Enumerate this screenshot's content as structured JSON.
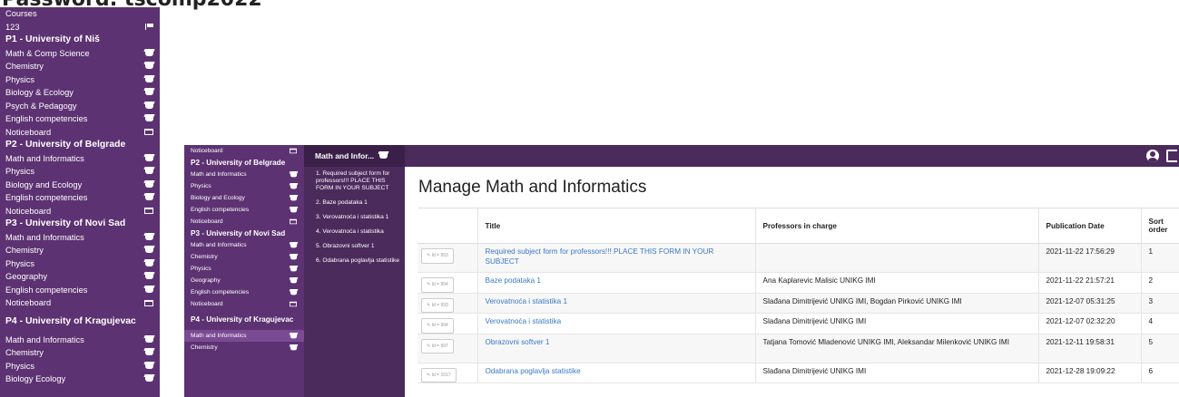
{
  "heading": "Password: tscomp2022",
  "sidebar_left": {
    "items": [
      {
        "label": "Courses",
        "type": "item",
        "icon": ""
      },
      {
        "label": "123",
        "type": "item",
        "icon": "flag-icon"
      },
      {
        "label": "P1 - University of Niš",
        "type": "head",
        "icon": ""
      },
      {
        "label": "Math & Comp Science",
        "type": "item",
        "icon": "graduation-cap-icon"
      },
      {
        "label": "Chemistry",
        "type": "item",
        "icon": "graduation-cap-icon"
      },
      {
        "label": "Physics",
        "type": "item",
        "icon": "graduation-cap-icon"
      },
      {
        "label": "Biology & Ecology",
        "type": "item",
        "icon": "graduation-cap-icon"
      },
      {
        "label": "Psych & Pedagogy",
        "type": "item",
        "icon": "graduation-cap-icon"
      },
      {
        "label": "English competencies",
        "type": "item",
        "icon": "graduation-cap-icon"
      },
      {
        "label": "Noticeboard",
        "type": "item",
        "icon": "noticeboard-icon"
      },
      {
        "label": "P2 - University of Belgrade",
        "type": "head",
        "icon": ""
      },
      {
        "label": "Math and Informatics",
        "type": "item",
        "icon": "graduation-cap-icon"
      },
      {
        "label": "Physics",
        "type": "item",
        "icon": "graduation-cap-icon"
      },
      {
        "label": "Biology and Ecology",
        "type": "item",
        "icon": "graduation-cap-icon"
      },
      {
        "label": "English competencies",
        "type": "item",
        "icon": "graduation-cap-icon"
      },
      {
        "label": "Noticeboard",
        "type": "item",
        "icon": "noticeboard-icon"
      },
      {
        "label": "P3 - University of Novi Sad",
        "type": "head",
        "icon": ""
      },
      {
        "label": "Math and Informatics",
        "type": "item",
        "icon": "graduation-cap-icon"
      },
      {
        "label": "Chemistry",
        "type": "item",
        "icon": "graduation-cap-icon"
      },
      {
        "label": "Physics",
        "type": "item",
        "icon": "graduation-cap-icon"
      },
      {
        "label": "Geography",
        "type": "item",
        "icon": "graduation-cap-icon"
      },
      {
        "label": "English competencies",
        "type": "item",
        "icon": "graduation-cap-icon"
      },
      {
        "label": "Noticeboard",
        "type": "item",
        "icon": "noticeboard-icon"
      },
      {
        "label": "P4 - University of Kragujevac",
        "type": "head-tall",
        "icon": ""
      },
      {
        "label": "Math and Informatics",
        "type": "item",
        "icon": "graduation-cap-icon"
      },
      {
        "label": "Chemistry",
        "type": "item",
        "icon": "graduation-cap-icon"
      },
      {
        "label": "Physics",
        "type": "item",
        "icon": "graduation-cap-icon"
      },
      {
        "label": "Biology Ecology",
        "type": "item",
        "icon": "graduation-cap-icon"
      }
    ]
  },
  "sidebar_mid": {
    "items": [
      {
        "label": "Noticeboard",
        "type": "item",
        "icon": "noticeboard-icon",
        "active": false
      },
      {
        "label": "P2 - University of Belgrade",
        "type": "head",
        "icon": "",
        "active": false
      },
      {
        "label": "Math and Informatics",
        "type": "item",
        "icon": "graduation-cap-icon",
        "active": false
      },
      {
        "label": "Physics",
        "type": "item",
        "icon": "graduation-cap-icon",
        "active": false
      },
      {
        "label": "Biology and Ecology",
        "type": "item",
        "icon": "graduation-cap-icon",
        "active": false
      },
      {
        "label": "English competencies",
        "type": "item",
        "icon": "graduation-cap-icon",
        "active": false
      },
      {
        "label": "Noticeboard",
        "type": "item",
        "icon": "noticeboard-icon",
        "active": false
      },
      {
        "label": "P3 - University of Novi Sad",
        "type": "head",
        "icon": "",
        "active": false
      },
      {
        "label": "Math and Informatics",
        "type": "item",
        "icon": "graduation-cap-icon",
        "active": false
      },
      {
        "label": "Chemistry",
        "type": "item",
        "icon": "graduation-cap-icon",
        "active": false
      },
      {
        "label": "Physics",
        "type": "item",
        "icon": "graduation-cap-icon",
        "active": false
      },
      {
        "label": "Geography",
        "type": "item",
        "icon": "graduation-cap-icon",
        "active": false
      },
      {
        "label": "English competencies",
        "type": "item",
        "icon": "graduation-cap-icon",
        "active": false
      },
      {
        "label": "Noticeboard",
        "type": "item",
        "icon": "noticeboard-icon",
        "active": false
      },
      {
        "label": "P4 - University of Kragujevac",
        "type": "head-tall",
        "icon": "",
        "active": false
      },
      {
        "label": "Math and Informatics",
        "type": "item",
        "icon": "graduation-cap-icon",
        "active": true
      },
      {
        "label": "Chemistry",
        "type": "item",
        "icon": "graduation-cap-icon",
        "active": false
      }
    ]
  },
  "subjects": {
    "title": "Math and Infor...",
    "items": [
      "1. Required subject form for professors!!! PLACE THIS FORM IN YOUR SUBJECT",
      "2. Baze podataka 1",
      "3. Verovatnoća i statistika 1",
      "4. Verovatnoća i statistika",
      "5. Obrazovni softver 1",
      "6. Odabrana poglavlja statistike"
    ]
  },
  "main": {
    "title": "Manage Math and Informatics",
    "columns": [
      "",
      "Title",
      "Professors in charge",
      "Publication Date",
      "Sort order"
    ],
    "rows": [
      {
        "id": "Id = 953",
        "title": "Required subject form for professors!!! PLACE THIS FORM IN YOUR SUBJECT",
        "professors": "",
        "date": "2021-11-22 17:56:29",
        "order": "1"
      },
      {
        "id": "Id = 954",
        "title": "Baze podataka 1",
        "professors": "Ana Kaplarevic Malisic UNIKG IMI",
        "date": "2021-11-22 21:57:21",
        "order": "2"
      },
      {
        "id": "Id = 993",
        "title": "Verovatnoća i statistika 1",
        "professors": "Slađana Dimitrijević UNIKG IMI, Bogdan Pirković UNIKG IMI",
        "date": "2021-12-07 05:31:25",
        "order": "3"
      },
      {
        "id": "Id = 994",
        "title": "Verovatnoća i statistika",
        "professors": "Slađana Dimitrijević UNIKG IMI",
        "date": "2021-12-07 02:32:20",
        "order": "4"
      },
      {
        "id": "Id = 997",
        "title": "Obrazovni softver 1",
        "professors": "Tatjana Tomović Mladenović UNIKG IMI, Aleksandar Milenković UNIKG IMI",
        "date": "2021-12-11 19:58:31",
        "order": "5"
      },
      {
        "id": "Id = 1017",
        "title": "Odabrana poglavlja statistike",
        "professors": "Slađana Dimitrijević UNIKG IMI",
        "date": "2021-12-28 19:09:22",
        "order": "6"
      }
    ]
  },
  "colors": {
    "sidebar": "#5d3272",
    "topbar": "#4b2a5c",
    "link": "#3a78c7"
  }
}
